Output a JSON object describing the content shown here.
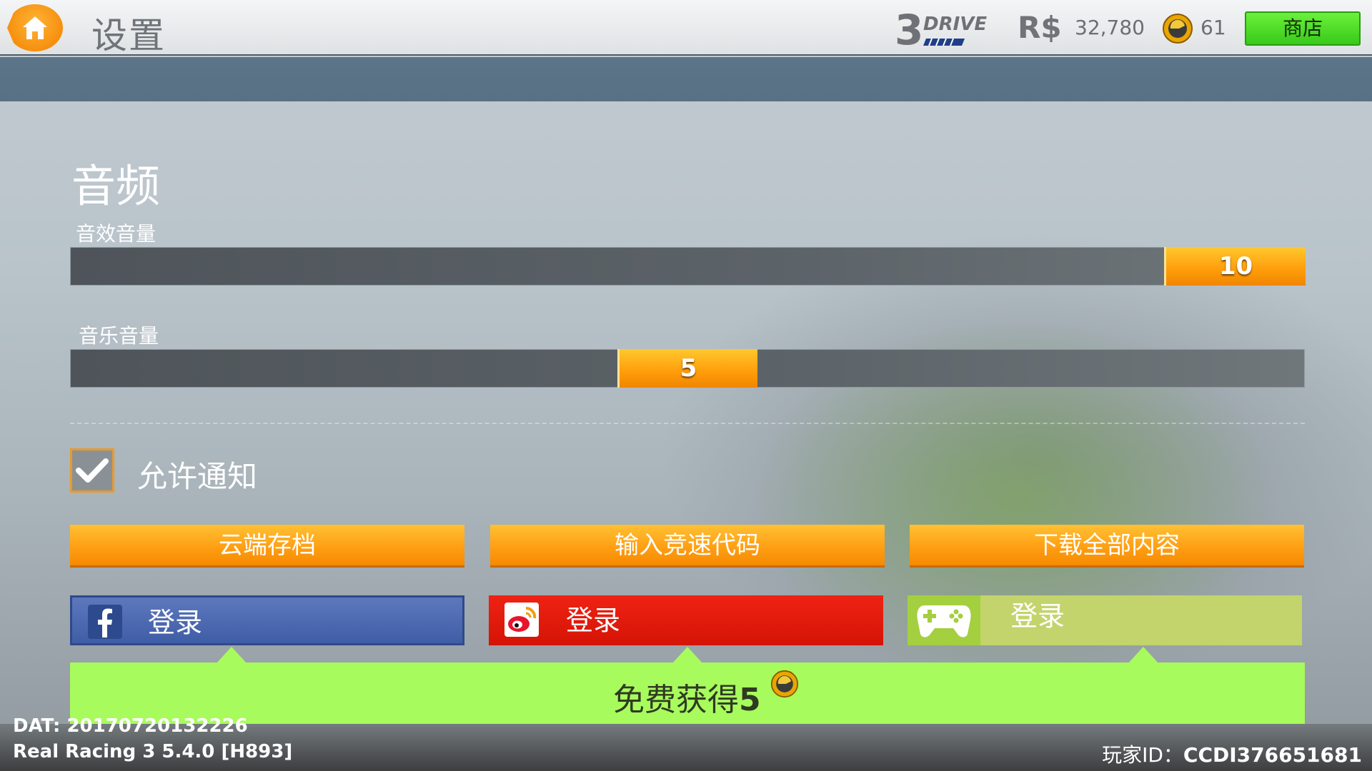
{
  "header": {
    "title": "设置",
    "logo_number": "3",
    "logo_word": "DRIVE",
    "currency_symbol": "R$",
    "currency_amount": "32,780",
    "gold_amount": "61",
    "shop_label": "商店"
  },
  "audio": {
    "section_title": "音频",
    "sfx_label": "音效音量",
    "sfx_value": "10",
    "music_label": "音乐音量",
    "music_value": "5"
  },
  "notifications": {
    "label": "允许通知",
    "checked": true
  },
  "actions": {
    "cloud_save": "云端存档",
    "enter_code": "输入竞速代码",
    "download_all": "下载全部内容"
  },
  "logins": {
    "facebook": "登录",
    "weibo": "登录",
    "game_center": "登录"
  },
  "promo": {
    "text": "免费获得",
    "amount": "5"
  },
  "footer": {
    "dat": "DAT: 20170720132226",
    "version": "Real Racing 3 5.4.0 [H893]",
    "player_label": "玩家ID：",
    "player_id": "CCDI376651681"
  },
  "colors": {
    "accent_orange": "#ff9f14",
    "shop_green": "#37c91a",
    "facebook_blue": "#3f5da6",
    "weibo_red": "#d41405",
    "promo_green": "#a8fb5c"
  },
  "icons": {
    "home": "home-icon",
    "gold": "gold-coin-icon",
    "facebook": "facebook-icon",
    "weibo": "weibo-icon",
    "gamepad": "gamepad-icon",
    "check": "checkmark-icon"
  }
}
